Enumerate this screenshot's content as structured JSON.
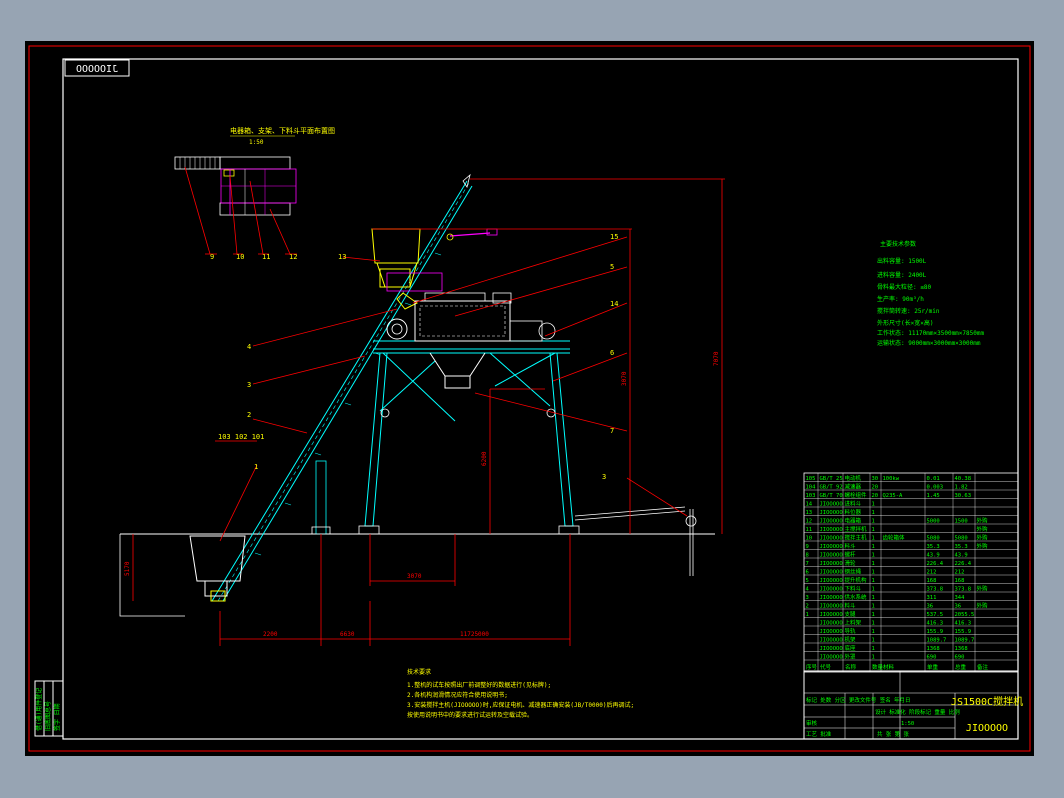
{
  "drawing": {
    "code_stamp": "JIOOOOO",
    "code_main": "JIOOOOO",
    "title_block_name": "JS1500C搅拌机",
    "scale": "1:50",
    "detail_title": "电器箱、支架、下料斗平面布置图",
    "detail_callouts": [
      "9",
      "10",
      "11",
      "12"
    ],
    "callouts": [
      "15",
      "5",
      "14",
      "6",
      "7",
      "3",
      "4",
      "3",
      "2",
      "1",
      "13"
    ],
    "callout_group": "103 102 101",
    "dims": [
      "7070",
      "3070",
      "6200",
      "3070",
      "2200",
      "6630",
      "11725000",
      "5170",
      "3070"
    ]
  },
  "params": {
    "title": "主要技术参数",
    "lines": [
      "出料容量: 1500L",
      "进料容量: 2400L",
      "骨料最大粒径: ≤80",
      "生产率: 90m³/h",
      "搅拌筒转速: 25r/min",
      "外形尺寸(长×宽×高)",
      "工作状态: 11170mm×3500mm×7850mm",
      "运输状态: 9000mm×3000mm×3000mm"
    ]
  },
  "notes": {
    "title": "技术要求",
    "lines": [
      "1.整机的试车按照出厂前调整好的数据进行(见标牌);",
      "2.各机构润滑情况应符合使用说明书;",
      "3.安装搅拌主机(JIOOOOO)时,应保证电机、减速器正确安装(JB/T0000)后再调试;",
      "  按使用说明书中的要求进行试运转及空载试验。"
    ]
  },
  "bom": {
    "rows": [
      [
        "105",
        "GB/T 25",
        "电动机",
        "30",
        "100kw",
        "0.01",
        "40.38",
        ""
      ],
      [
        "104",
        "GB/T 92",
        "减速器",
        "20",
        "",
        "0.003",
        "1.82",
        ""
      ],
      [
        "103",
        "GB/T 70",
        "螺栓组件",
        "20",
        "Q235-A",
        "1.45",
        "30.63",
        ""
      ],
      [
        "14",
        "JIOOOOO",
        "进料斗",
        "1",
        "",
        "",
        "",
        ""
      ],
      [
        "13",
        "JIOOOOO",
        "料位器",
        "1",
        "",
        "",
        "",
        ""
      ],
      [
        "12",
        "JIOOOOO",
        "电器箱",
        "1",
        "",
        "5000",
        "1500",
        "外购"
      ],
      [
        "11",
        "JIOOOOO",
        "主搅拌机",
        "1",
        "",
        "",
        "",
        "外购"
      ],
      [
        "10",
        "JIOOOOO",
        "搅拌主机",
        "1",
        "齿轮箱体",
        "5080",
        "5080",
        "外购"
      ],
      [
        "9",
        "JIOOOOO",
        "料斗",
        "1",
        "",
        "35.3",
        "35.3",
        "外购"
      ],
      [
        "8",
        "JIOOOOO",
        "螺杆",
        "1",
        "",
        "43.9",
        "43.9",
        ""
      ],
      [
        "7",
        "JIOOOOO",
        "滑轮",
        "1",
        "",
        "226.4",
        "226.4",
        ""
      ],
      [
        "6",
        "JIOOOOO",
        "钢丝绳",
        "1",
        "",
        "212",
        "212",
        ""
      ],
      [
        "5",
        "JIOOOOO",
        "提升机构",
        "1",
        "",
        "168",
        "168",
        ""
      ],
      [
        "4",
        "JIOOOOO",
        "下料斗",
        "1",
        "",
        "373.8",
        "373.8",
        "外购"
      ],
      [
        "3",
        "JIOOOOO",
        "供水系统",
        "1",
        "",
        "311",
        "344",
        ""
      ],
      [
        "2",
        "JIOOOOO",
        "料斗",
        "1",
        "",
        "36",
        "36",
        "外购"
      ],
      [
        "1",
        "JIOOOOO",
        "支腿",
        "1",
        "",
        "537.5",
        "2055.5",
        ""
      ],
      [
        "",
        "JIOOOOO",
        "上料架",
        "1",
        "",
        "416.3",
        "416.3",
        ""
      ],
      [
        "",
        "JIOOOOO",
        "导轨",
        "1",
        "",
        "155.9",
        "155.9",
        ""
      ],
      [
        "",
        "JIOOOOO",
        "机架",
        "1",
        "",
        "1089.7",
        "1089.7",
        ""
      ],
      [
        "",
        "JIOOOOO",
        "底座",
        "1",
        "",
        "1368",
        "1368",
        ""
      ],
      [
        "",
        "JIOOOOO",
        "外罩",
        "1",
        "",
        "690",
        "690",
        ""
      ]
    ],
    "header": [
      "序号",
      "代号",
      "名称",
      "数量",
      "材料",
      "单重",
      "总重",
      "备注"
    ]
  },
  "title_block": {
    "rows": [
      "标记 处数 分区 更改文件号 签名 年月日",
      "设计 标准化 阶段标记 重量 比例",
      "审核",
      "工艺 批准"
    ],
    "sheet": "共 张 第 张",
    "scale_text": "1:50"
  },
  "colors": {
    "cyan": "#00ffff",
    "green": "#00ff00",
    "red": "#ff0000",
    "magenta": "#ff00ff",
    "white": "#ffffff",
    "yellow": "#ffff00"
  }
}
